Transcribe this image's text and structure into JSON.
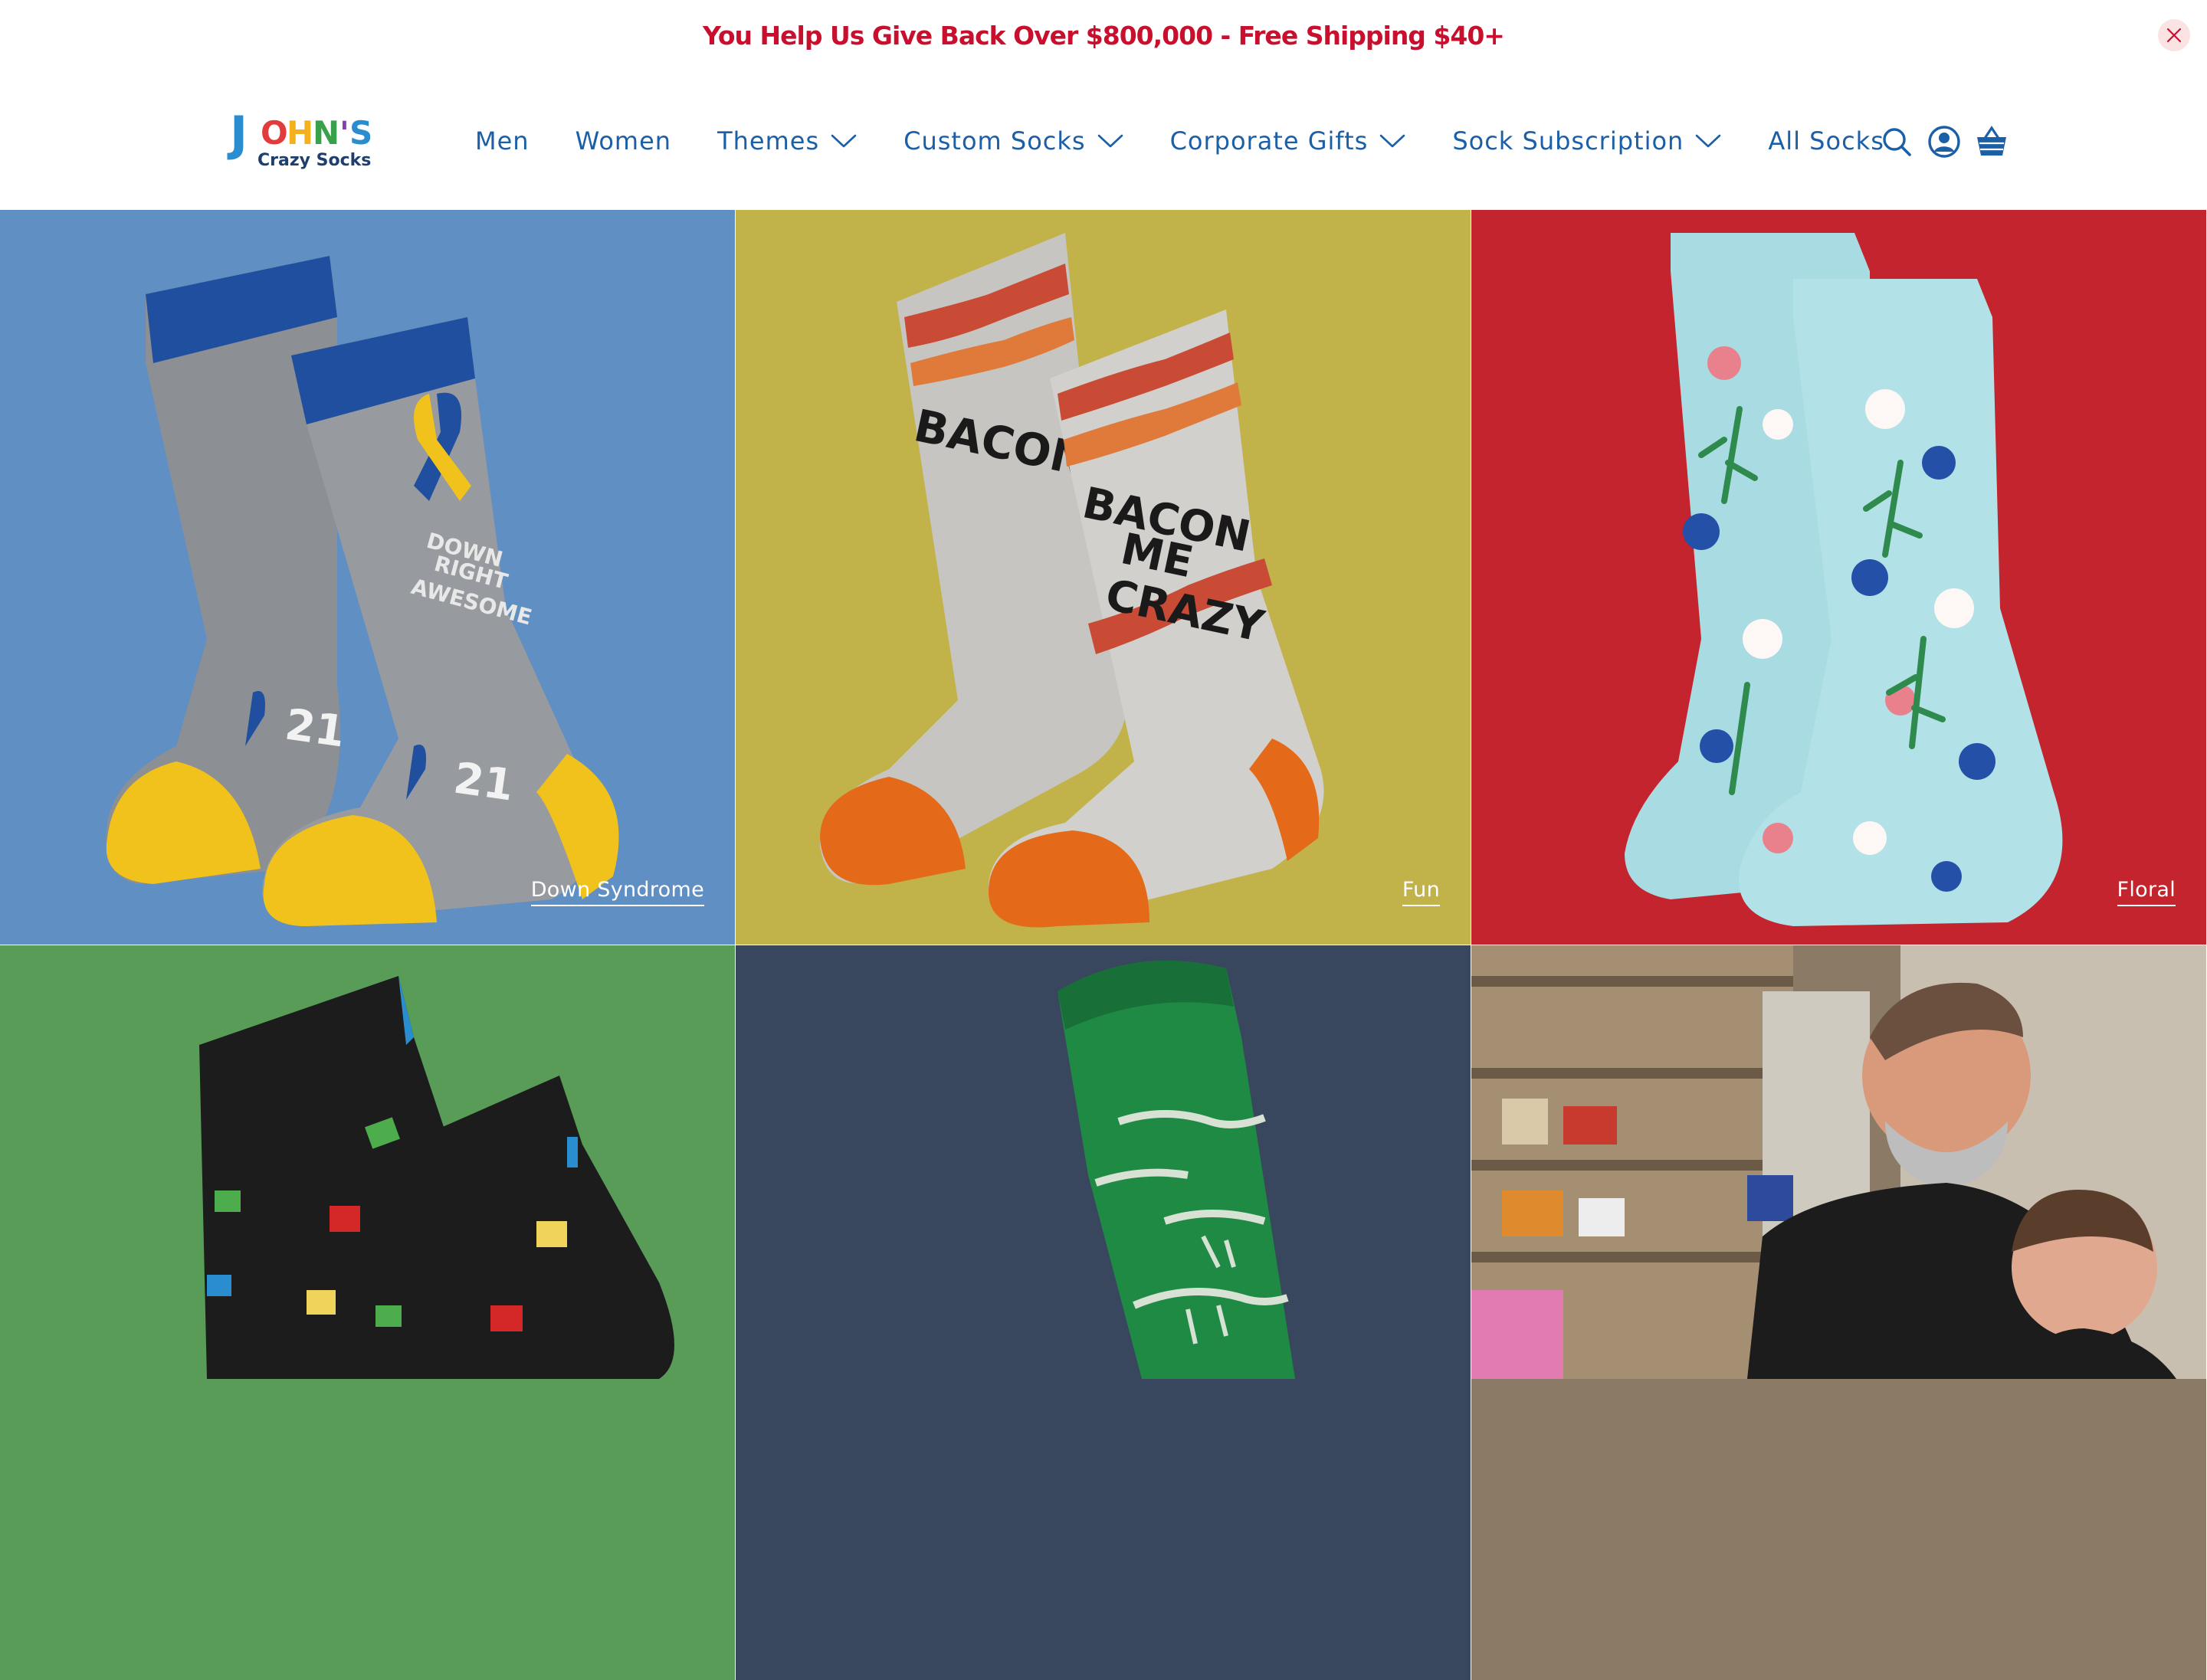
{
  "announcement": {
    "text": "You Help Us Give Back Over $800,000 - Free Shipping $40+",
    "close_icon": "close-icon",
    "color": "#c8102e"
  },
  "logo": {
    "brand": "JOHN'S",
    "tagline": "Crazy Socks"
  },
  "nav": {
    "color": "#1b5fa6",
    "items": [
      {
        "label": "Men"
      },
      {
        "label": "Women"
      },
      {
        "label": "Themes",
        "dropdown": true
      },
      {
        "label": "Custom Socks",
        "dropdown": true
      },
      {
        "label": "Corporate Gifts",
        "dropdown": true
      },
      {
        "label": "Sock Subscription",
        "dropdown": true
      },
      {
        "label": "All Socks"
      }
    ]
  },
  "header_icons": [
    "search-icon",
    "account-icon",
    "cart-icon"
  ],
  "tiles": [
    {
      "label": "Down Syndrome",
      "bg": "#5f8fc3"
    },
    {
      "label": "Fun",
      "bg": "#c2b24a"
    },
    {
      "label": "Floral",
      "bg": "#c3242d"
    },
    {
      "label": "",
      "bg": "#589c57"
    },
    {
      "label": "",
      "bg": "#38465e"
    },
    {
      "label": "",
      "bg": "#8a7a66"
    }
  ]
}
